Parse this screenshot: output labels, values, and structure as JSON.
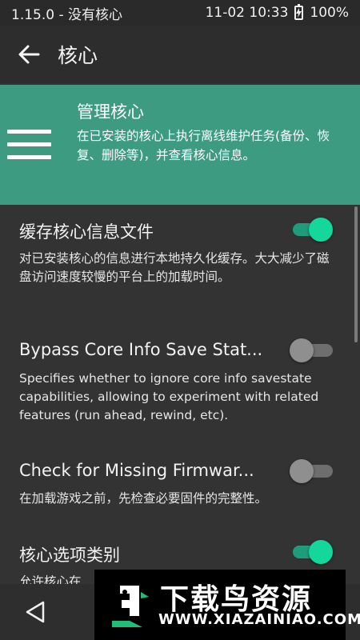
{
  "status_bar": {
    "left_text": "1.15.0 - 没有核心",
    "datetime": "11-02 10:33",
    "battery": "100%"
  },
  "app_bar": {
    "title": "核心"
  },
  "header": {
    "title": "管理核心",
    "description": "在已安装的核心上执行离线维护任务(备份、恢复、删除等)，并查看核心信息。"
  },
  "settings": [
    {
      "title": "缓存核心信息文件",
      "description": "对已安装核心的信息进行本地持久化缓存。大大减少了磁盘访问速度较慢的平台上的加载时间。",
      "enabled": true
    },
    {
      "title": "Bypass Core Info Save Stat...",
      "description": "Specifies whether to ignore core info savestate capabilities, allowing to experiment with related features (run ahead, rewind, etc).",
      "enabled": false
    },
    {
      "title": "Check for Missing Firmwar...",
      "description": "在加载游戏之前，先检查必要固件的完整性。",
      "enabled": false
    },
    {
      "title": "核心选项类别",
      "description": "允许核心在",
      "enabled": true
    }
  ],
  "watermark": {
    "title": "下载鸟资源",
    "url": "WWW.XIAZAINIAO.COM"
  },
  "colors": {
    "accent": "#3d9b82",
    "toggle_on": "#14d79b",
    "background": "#333333"
  }
}
